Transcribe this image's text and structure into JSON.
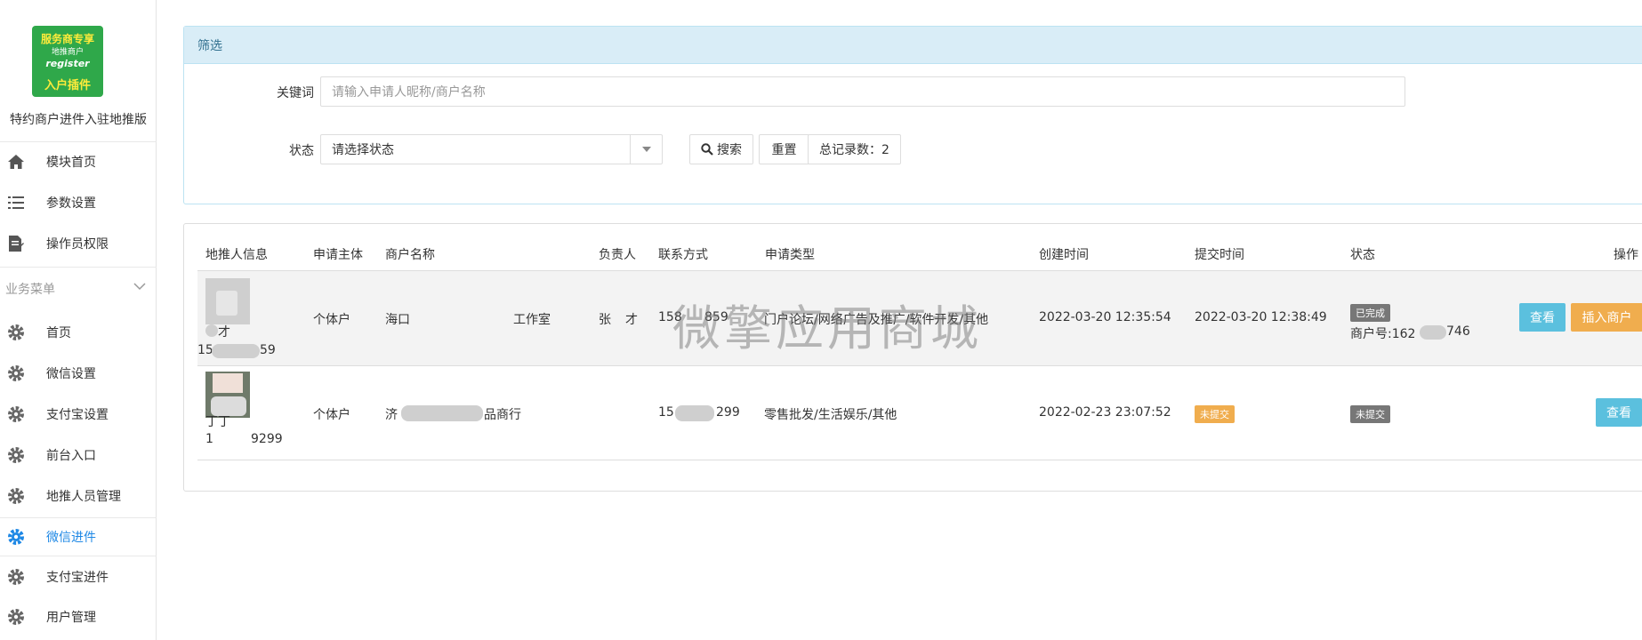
{
  "app": {
    "logo_line1": "服务商专享",
    "logo_line2": "地推商户",
    "logo_line3": "register",
    "logo_line4": "入户插件",
    "name": "特约商户进件入驻地推版"
  },
  "sidebar": {
    "top_items": [
      {
        "label": "模块首页",
        "icon": "home-icon"
      },
      {
        "label": "参数设置",
        "icon": "list-icon"
      },
      {
        "label": "操作员权限",
        "icon": "edit-doc-icon"
      }
    ],
    "section_title": "业务菜单",
    "menu_items": [
      {
        "label": "首页",
        "icon": "gear-icon"
      },
      {
        "label": "微信设置",
        "icon": "gear-icon"
      },
      {
        "label": "支付宝设置",
        "icon": "gear-icon"
      },
      {
        "label": "前台入口",
        "icon": "gear-icon"
      },
      {
        "label": "地推人员管理",
        "icon": "gear-icon"
      },
      {
        "label": "微信进件",
        "icon": "gear-icon",
        "active": true
      },
      {
        "label": "支付宝进件",
        "icon": "gear-icon"
      },
      {
        "label": "用户管理",
        "icon": "gear-icon"
      }
    ]
  },
  "filter": {
    "title": "筛选",
    "keyword_label": "关键词",
    "keyword_placeholder": "请输入申请人昵称/商户名称",
    "status_label": "状态",
    "status_value": "请选择状态",
    "search_label": "搜索",
    "reset_label": "重置",
    "total_label": "总记录数：2"
  },
  "table": {
    "headers": [
      "地推人信息",
      "申请主体",
      "商户名称",
      "负责人",
      "联系方式",
      "申请类型",
      "创建时间",
      "提交时间",
      "状态",
      "操作"
    ],
    "rows": [
      {
        "promoter_name": "才",
        "promoter_phone_prefix": "15",
        "promoter_phone_suffix": "59",
        "subject": "个体户",
        "merchant_prefix": "海口",
        "merchant_suffix": "工作室",
        "owner_a": "张",
        "owner_b": "才",
        "phone_prefix": "158",
        "phone_suffix": "859",
        "type": "门户论坛/网络广告及推广/软件开发/其他",
        "created": "2022-03-20 12:35:54",
        "submitted": "2022-03-20 12:38:49",
        "status_badge": "已完成",
        "merchant_no_prefix": "商户号:162",
        "merchant_no_suffix": "746",
        "view_label": "查看",
        "insert_label": "插入商户"
      },
      {
        "promoter_name": "丁丁",
        "promoter_phone_prefix": "1",
        "promoter_phone_suffix": "9299",
        "subject": "个体户",
        "merchant_prefix": "济",
        "merchant_suffix": "品商行",
        "phone_prefix": "15",
        "phone_suffix": "299",
        "type": "零售批发/生活娱乐/其他",
        "created": "2022-02-23 23:07:52",
        "submitted_badge": "未提交",
        "status_badge": "未提交",
        "view_label": "查看"
      }
    ]
  },
  "watermark": "微擎应用商城",
  "colors": {
    "active": "#1e88e5",
    "filter_head_bg": "#d9edf7",
    "info_button": "#5bc0de",
    "warn_button": "#f0ad4e",
    "badge_gray": "#777777"
  }
}
